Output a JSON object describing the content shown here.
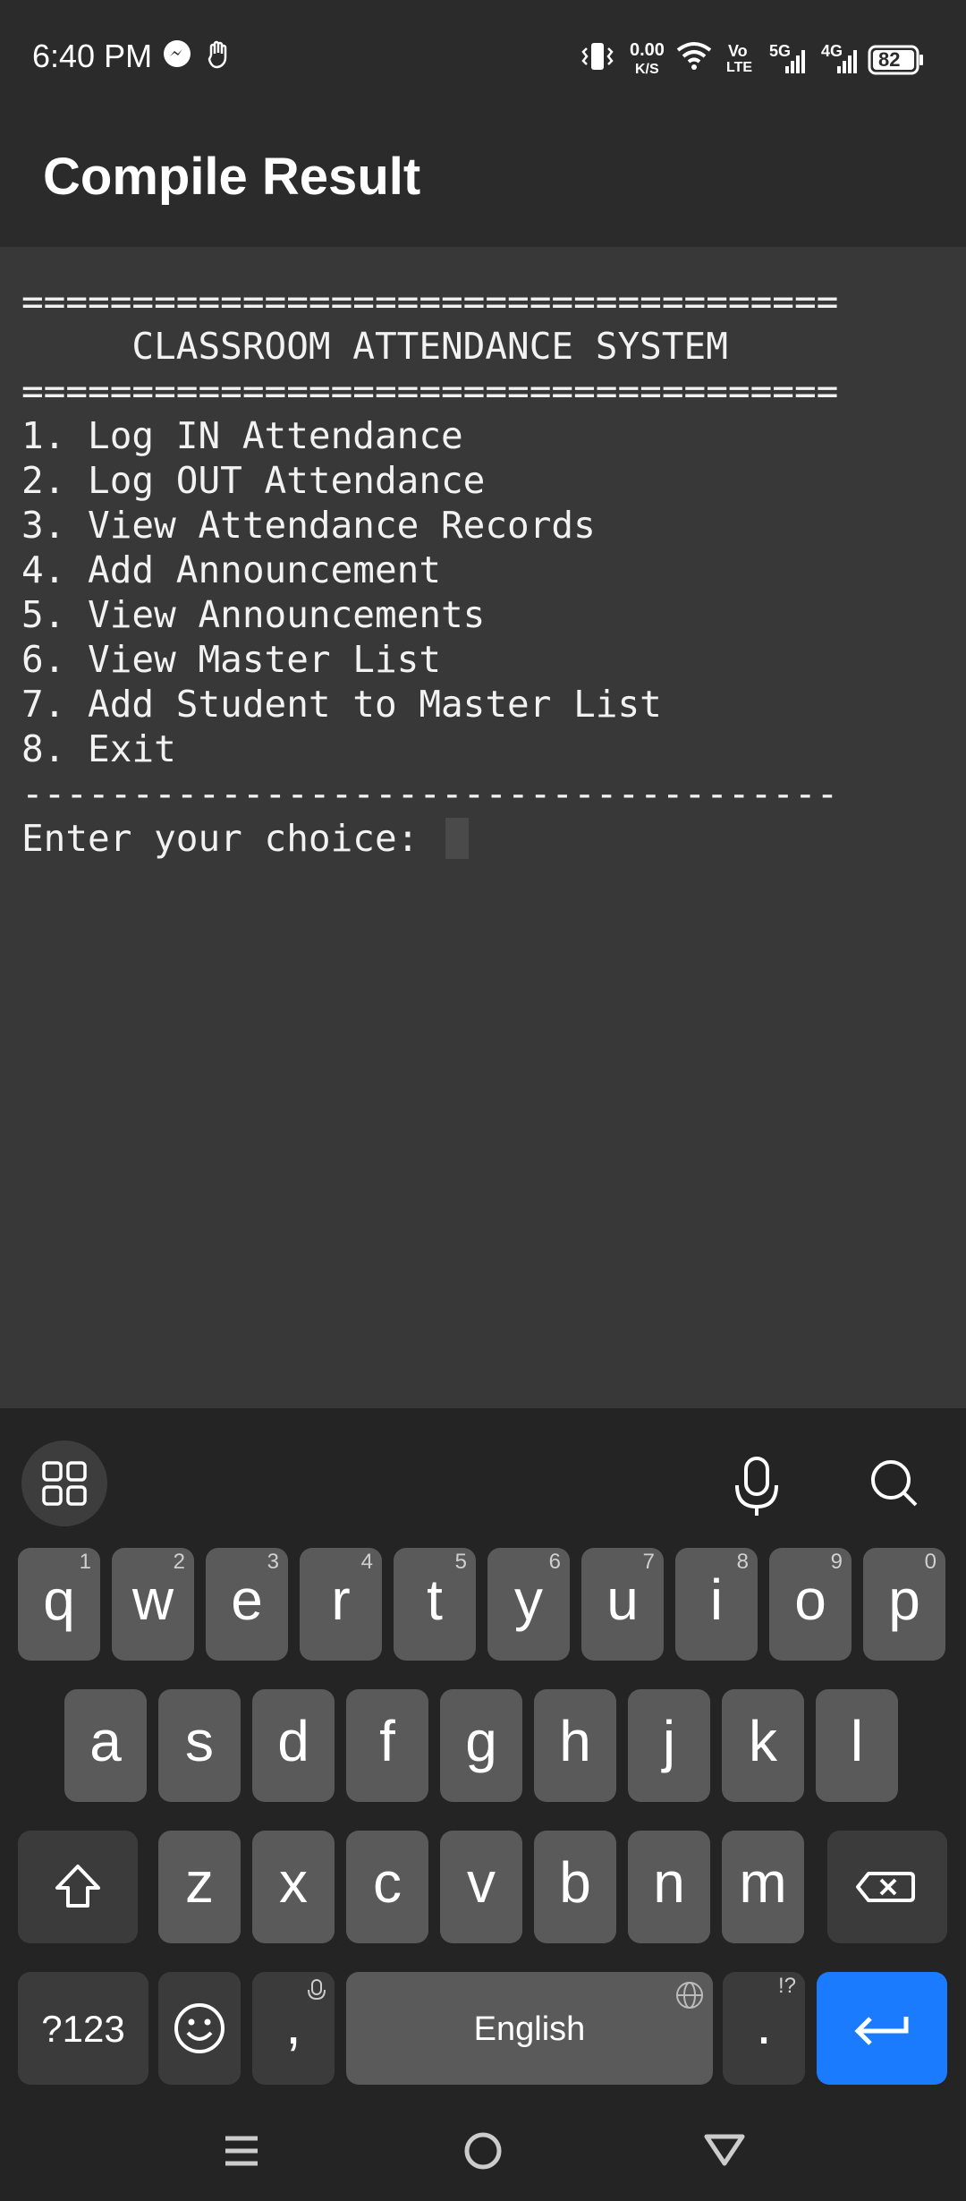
{
  "status_bar": {
    "time": "6:40 PM",
    "net_speed_value": "0.00",
    "net_speed_unit": "K/S",
    "volte_top": "Vo",
    "volte_bottom": "LTE",
    "signal1_label": "5G",
    "signal2_label": "4G",
    "battery": "82",
    "icons": [
      "messenger-icon",
      "hand-icon",
      "vibrate-icon",
      "wifi-icon",
      "signal-icon",
      "battery-icon"
    ]
  },
  "app_bar": {
    "title": "Compile Result"
  },
  "console": {
    "lines": [
      "=====================================",
      "     CLASSROOM ATTENDANCE SYSTEM",
      "=====================================",
      "1. Log IN Attendance",
      "2. Log OUT Attendance",
      "3. View Attendance Records",
      "4. Add Announcement",
      "5. View Announcements",
      "6. View Master List",
      "7. Add Student to Master List",
      "8. Exit",
      "-------------------------------------",
      "Enter your choice: "
    ]
  },
  "keyboard": {
    "row1": [
      {
        "key": "q",
        "hint": "1"
      },
      {
        "key": "w",
        "hint": "2"
      },
      {
        "key": "e",
        "hint": "3"
      },
      {
        "key": "r",
        "hint": "4"
      },
      {
        "key": "t",
        "hint": "5"
      },
      {
        "key": "y",
        "hint": "6"
      },
      {
        "key": "u",
        "hint": "7"
      },
      {
        "key": "i",
        "hint": "8"
      },
      {
        "key": "o",
        "hint": "9"
      },
      {
        "key": "p",
        "hint": "0"
      }
    ],
    "row2": [
      "a",
      "s",
      "d",
      "f",
      "g",
      "h",
      "j",
      "k",
      "l"
    ],
    "row3": [
      "z",
      "x",
      "c",
      "v",
      "b",
      "n",
      "m"
    ],
    "symbols_label": "?123",
    "comma_label": ",",
    "space_label": "English",
    "period_label": ".",
    "period_hint": "!?",
    "enter_color": "#1a7bff"
  }
}
